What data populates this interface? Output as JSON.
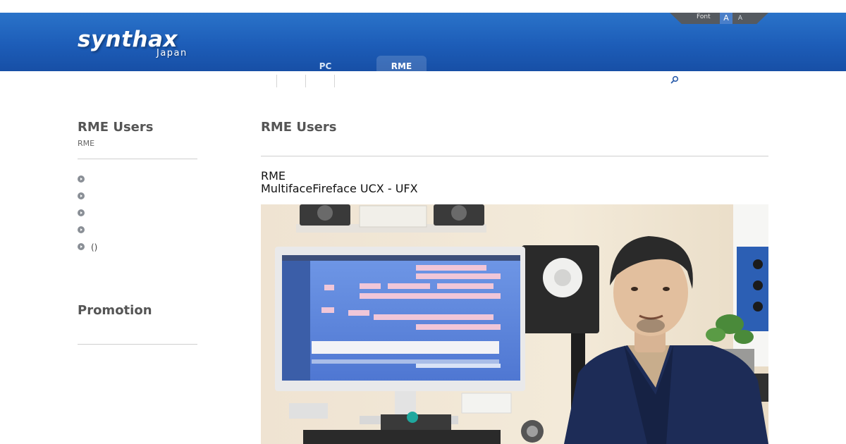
{
  "header": {
    "logo_main": "synthax",
    "logo_sub": "Japan",
    "font_label": "Font",
    "font_large": "A",
    "font_small": "A",
    "nav": [
      {
        "label": "PC"
      },
      {
        "label": "RME"
      }
    ],
    "search_icon": "search-icon"
  },
  "sidebar": {
    "title": "RME Users",
    "subtitle": "RME",
    "items": [
      {
        "label": ""
      },
      {
        "label": ""
      },
      {
        "label": ""
      },
      {
        "label": ""
      },
      {
        "label": "()"
      }
    ],
    "promo_title": "Promotion"
  },
  "main": {
    "title": "RME Users",
    "article_line1": "RME",
    "article_line2": "MultifaceFireface UCX - UFX"
  },
  "colors": {
    "header_blue": "#1d5db8",
    "accent": "#2a5caa"
  }
}
